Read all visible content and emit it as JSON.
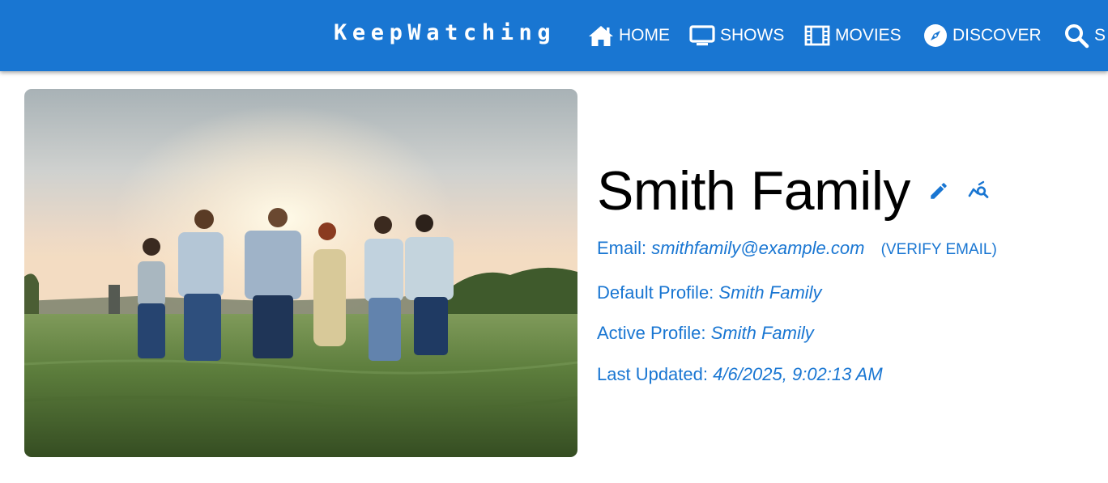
{
  "app": {
    "title": "KeepWatching"
  },
  "nav": {
    "items": [
      {
        "label": "HOME",
        "icon": "home-icon"
      },
      {
        "label": "SHOWS",
        "icon": "tv-icon"
      },
      {
        "label": "MOVIES",
        "icon": "film-icon"
      },
      {
        "label": "DISCOVER",
        "icon": "compass-icon"
      },
      {
        "label": "S",
        "icon": "search-icon"
      }
    ]
  },
  "account": {
    "name": "Smith Family",
    "email_label": "Email:",
    "email": "smithfamily@example.com",
    "verify_label": "(VERIFY EMAIL)",
    "default_profile_label": "Default Profile:",
    "default_profile": "Smith Family",
    "active_profile_label": "Active Profile:",
    "active_profile": "Smith Family",
    "last_updated_label": "Last Updated:",
    "last_updated": "4/6/2025, 9:02:13 AM"
  },
  "colors": {
    "primary": "#1976d2",
    "background": "#ffffff"
  }
}
